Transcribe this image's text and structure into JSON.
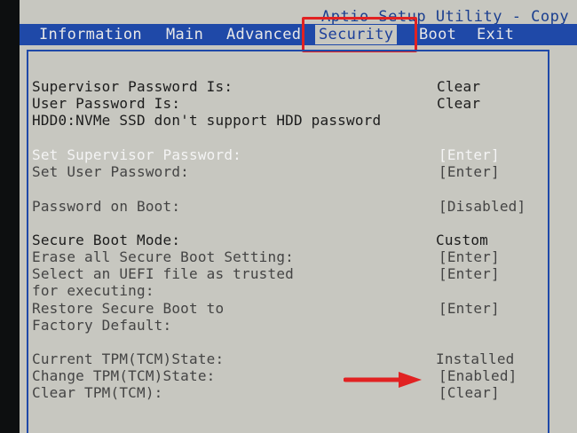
{
  "title": "Aptio Setup Utility - Copy",
  "menu": {
    "tabs": [
      "Information",
      "Main",
      "Advanced",
      "Security",
      "Boot",
      "Exit"
    ],
    "active": "Security"
  },
  "rows": [
    {
      "label": "Supervisor Password Is:",
      "value": "Clear"
    },
    {
      "label": "User Password Is:",
      "value": "Clear"
    },
    {
      "label": "HDD0:NVMe SSD don't support HDD password",
      "value": ""
    },
    {
      "label": "Set Supervisor Password:",
      "value": "[Enter]",
      "selected": true
    },
    {
      "label": "Set User Password:",
      "value": "[Enter]"
    },
    {
      "label": "Password on Boot:",
      "value": "[Disabled]"
    },
    {
      "label": "Secure Boot Mode:",
      "value": "Custom"
    },
    {
      "label": "Erase all Secure Boot Setting:",
      "value": "[Enter]"
    },
    {
      "label": "Select an UEFI file as trusted",
      "value": "[Enter]"
    },
    {
      "label": "for executing:",
      "value": ""
    },
    {
      "label": "Restore Secure Boot to",
      "value": "[Enter]"
    },
    {
      "label": "Factory Default:",
      "value": ""
    },
    {
      "label": "Current TPM(TCM)State:",
      "value": "Installed"
    },
    {
      "label": "Change TPM(TCM)State:",
      "value": "[Enabled]"
    },
    {
      "label": "Clear TPM(TCM):",
      "value": "[Clear]"
    }
  ],
  "colors": {
    "background": "#c7c7c0",
    "menubar": "#1f49a8",
    "highlight": "#e12222",
    "selected_text": "#f4f4f4"
  },
  "icons": {
    "annotation": "red-arrow-icon"
  }
}
